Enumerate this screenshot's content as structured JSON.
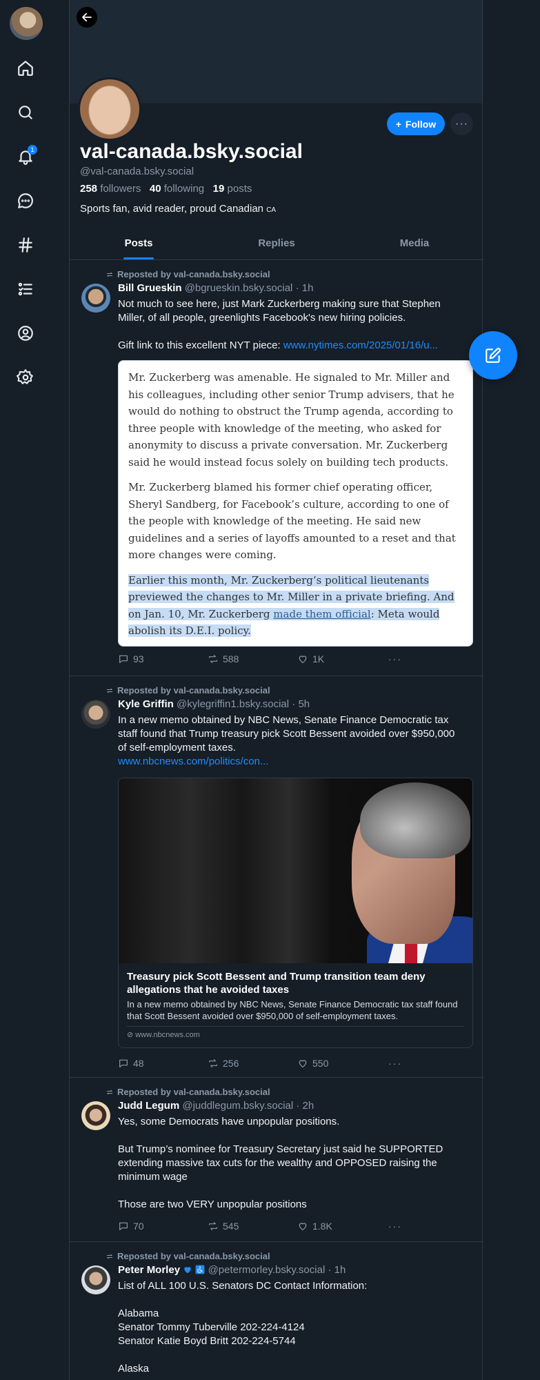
{
  "nav": {
    "items": [
      "home-icon",
      "search-icon",
      "bell-icon",
      "chat-icon",
      "hashtag-icon",
      "list-icon",
      "profile-icon",
      "gear-icon"
    ],
    "notification_count": "1"
  },
  "profile": {
    "display_name": "val-canada.bsky.social",
    "handle": "@val-canada.bsky.social",
    "followers_count": "258",
    "followers_label": "followers",
    "following_count": "40",
    "following_label": "following",
    "posts_count": "19",
    "posts_label": "posts",
    "bio": "Sports fan, avid reader, proud Canadian",
    "bio_flag": "CA",
    "follow_label": "Follow"
  },
  "tabs": [
    "Posts",
    "Replies",
    "Media"
  ],
  "colors": {
    "accent": "#1083fe",
    "background": "#161e27",
    "muted": "#8a99a8",
    "link": "#208bfe"
  },
  "posts": [
    {
      "repost_label": "Reposted by val-canada.bsky.social",
      "author": "Bill Grueskin",
      "handle": "@bgrueskin.bsky.social",
      "time": "· 1h",
      "text": "Not much to see here, just Mark Zuckerberg making sure that Stephen Miller, of all people, greenlights Facebook's new hiring policies.",
      "text2": "Gift link to this excellent NYT piece: ",
      "link": "www.nytimes.com/2025/01/16/u...",
      "quote": {
        "p1": "Mr. Zuckerberg was amenable. He signaled to Mr. Miller and his colleagues, including other senior Trump advisers, that he would do nothing to obstruct the Trump agenda, according to three people with knowledge of the meeting, who asked for anonymity to discuss a private conversation. Mr. Zuckerberg said he would instead focus solely on building tech products.",
        "p2": "Mr. Zuckerberg blamed his former chief operating officer, Sheryl Sandberg, for Facebook’s culture, according to one of the people with knowledge of the meeting. He said new guidelines and a series of layoffs amounted to a reset and that more changes were coming.",
        "p3a": "Earlier this month, Mr. Zuckerberg’s political lieutenants previewed the changes to Mr. Miller in a private briefing. And on Jan. 10, Mr. Zuckerberg ",
        "p3link": "made them official",
        "p3b": ": Meta would abolish its D.E.I. policy."
      },
      "replies": "93",
      "reposts": "588",
      "likes": "1K"
    },
    {
      "repost_label": "Reposted by val-canada.bsky.social",
      "author": "Kyle Griffin",
      "handle": "@kylegriffin1.bsky.social",
      "time": "· 5h",
      "text": "In a new memo obtained by NBC News, Senate Finance Democratic tax staff found that Trump treasury pick Scott Bessent avoided over $950,000 of self-employment taxes.",
      "link": "www.nbcnews.com/politics/con...",
      "card": {
        "title": "Treasury pick Scott Bessent and Trump transition team deny allegations that he avoided taxes",
        "description": "In a new memo obtained by NBC News, Senate Finance Democratic tax staff found that Scott Bessent avoided over $950,000 of self-employment taxes.",
        "domain": "www.nbcnews.com"
      },
      "replies": "48",
      "reposts": "256",
      "likes": "550"
    },
    {
      "repost_label": "Reposted by val-canada.bsky.social",
      "author": "Judd Legum",
      "handle": "@juddlegum.bsky.social",
      "time": "· 2h",
      "text": "Yes, some Democrats have unpopular positions.\n\nBut Trump’s nominee for Treasury Secretary just said he SUPPORTED extending massive tax cuts for the wealthy and OPPOSED raising the minimum wage\n\nThose are two VERY unpopular positions",
      "replies": "70",
      "reposts": "545",
      "likes": "1.8K"
    },
    {
      "repost_label": "Reposted by val-canada.bsky.social",
      "author": "Peter Morley",
      "handle": "@petermorley.bsky.social",
      "time": "· 1h",
      "text": "List of ALL 100 U.S. Senators DC Contact Information:\n\nAlabama\nSenator Tommy Tuberville 202-224-4124\nSenator Katie Boyd Britt 202-224-5744\n\nAlaska"
    }
  ]
}
